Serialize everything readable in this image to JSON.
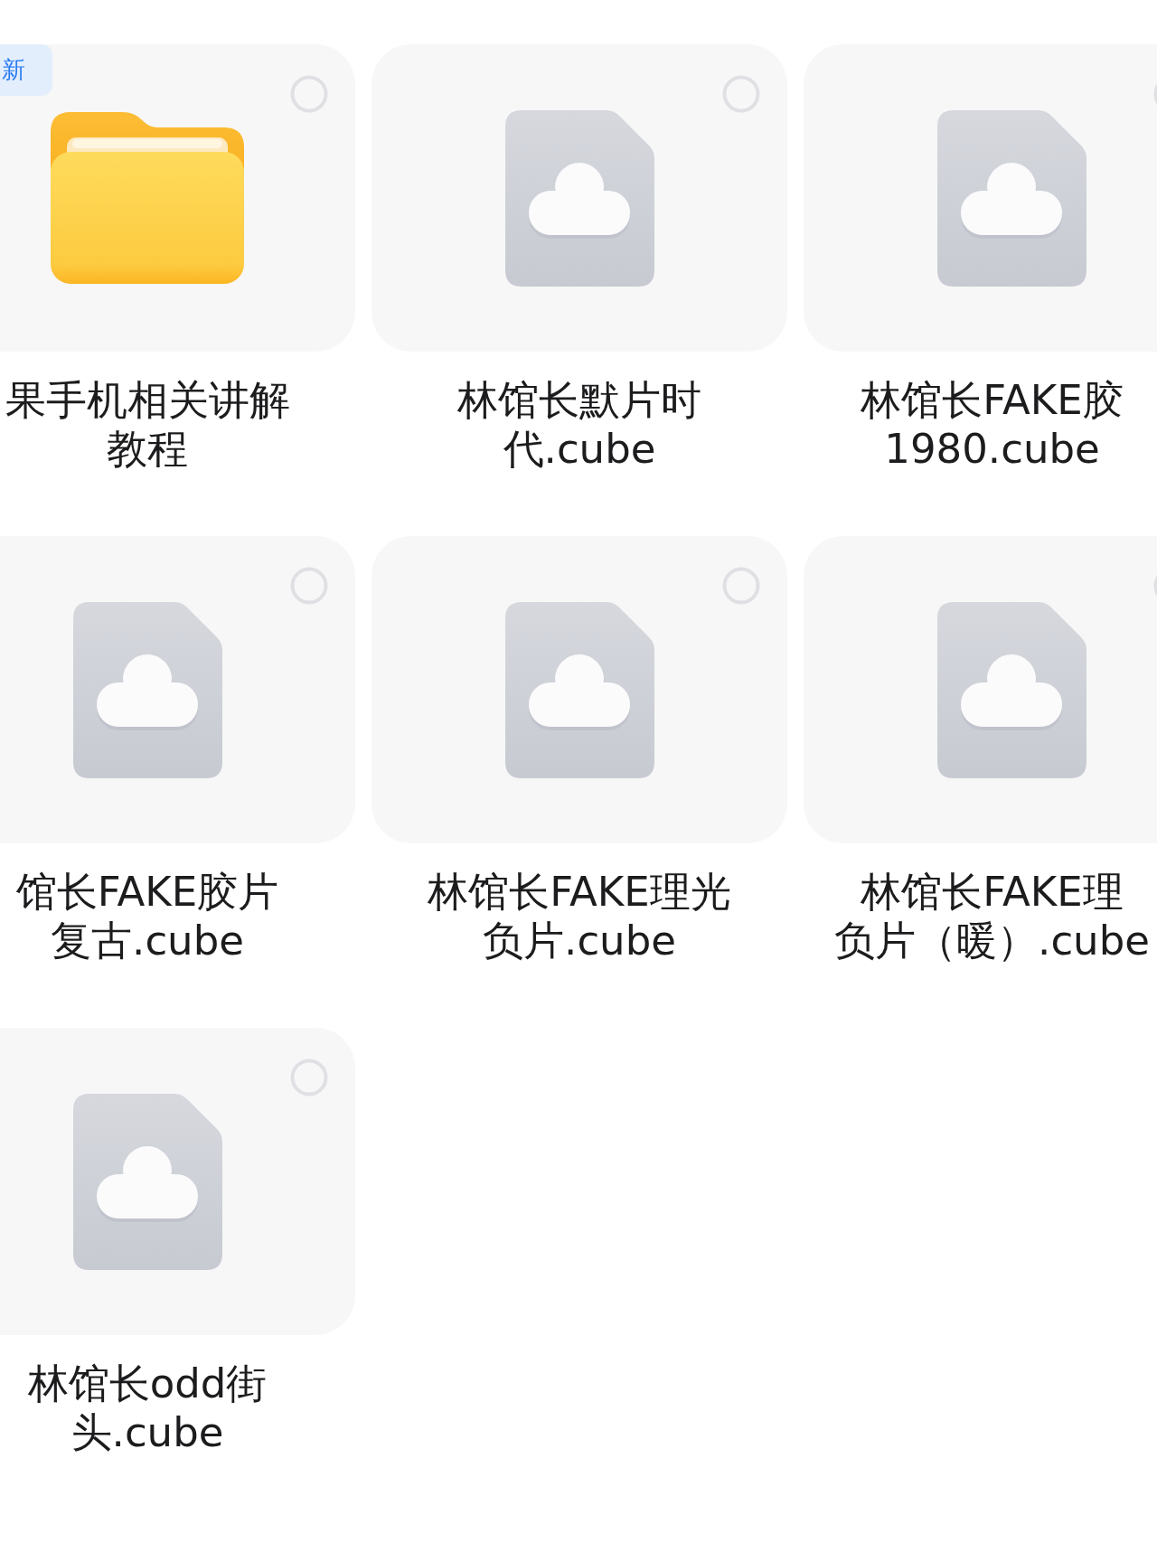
{
  "items": [
    {
      "kind": "folder",
      "badge": "新",
      "name": [
        "果手机相关讲解",
        "教程"
      ],
      "selected": false
    },
    {
      "kind": "file",
      "name": [
        "林馆长默片时",
        "代.cube"
      ],
      "selected": false
    },
    {
      "kind": "file",
      "name": [
        "林馆长FAKE胶",
        "1980.cube"
      ],
      "selected": false
    },
    {
      "kind": "file",
      "name": [
        "馆长FAKE胶片",
        "复古.cube"
      ],
      "selected": false
    },
    {
      "kind": "file",
      "name": [
        "林馆长FAKE理光",
        "负片.cube"
      ],
      "selected": false
    },
    {
      "kind": "file",
      "name": [
        "林馆长FAKE理",
        "负片（暖）.cube"
      ],
      "selected": false
    },
    {
      "kind": "file",
      "name": [
        "林馆长odd街",
        "头.cube"
      ],
      "selected": false
    }
  ]
}
